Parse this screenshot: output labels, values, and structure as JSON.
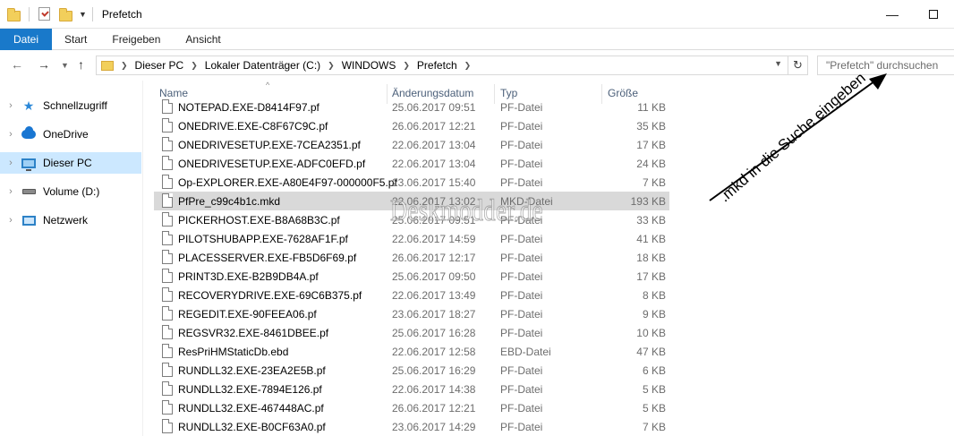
{
  "window": {
    "title": "Prefetch"
  },
  "ribbon": {
    "tabs": [
      "Datei",
      "Start",
      "Freigeben",
      "Ansicht"
    ]
  },
  "address": {
    "crumbs": [
      "Dieser PC",
      "Lokaler Datenträger (C:)",
      "WINDOWS",
      "Prefetch"
    ],
    "search_placeholder": "\"Prefetch\" durchsuchen"
  },
  "sidebar": {
    "items": [
      {
        "label": "Schnellzugriff",
        "icon": "star-icon"
      },
      {
        "label": "OneDrive",
        "icon": "cloud-icon"
      },
      {
        "label": "Dieser PC",
        "icon": "computer-icon",
        "selected": true
      },
      {
        "label": "Volume (D:)",
        "icon": "drive-icon"
      },
      {
        "label": "Netzwerk",
        "icon": "network-icon"
      }
    ]
  },
  "columns": {
    "name": "Name",
    "date": "Änderungsdatum",
    "type": "Typ",
    "size": "Größe"
  },
  "files": [
    {
      "name": "NOTEPAD.EXE-D8414F97.pf",
      "date": "25.06.2017 09:51",
      "type": "PF-Datei",
      "size": "11 KB"
    },
    {
      "name": "ONEDRIVE.EXE-C8F67C9C.pf",
      "date": "26.06.2017 12:21",
      "type": "PF-Datei",
      "size": "35 KB"
    },
    {
      "name": "ONEDRIVESETUP.EXE-7CEA2351.pf",
      "date": "22.06.2017 13:04",
      "type": "PF-Datei",
      "size": "17 KB"
    },
    {
      "name": "ONEDRIVESETUP.EXE-ADFC0EFD.pf",
      "date": "22.06.2017 13:04",
      "type": "PF-Datei",
      "size": "24 KB"
    },
    {
      "name": "Op-EXPLORER.EXE-A80E4F97-000000F5.pf",
      "date": "23.06.2017 15:40",
      "type": "PF-Datei",
      "size": "7 KB"
    },
    {
      "name": "PfPre_c99c4b1c.mkd",
      "date": "22.06.2017 13:02",
      "type": "MKD-Datei",
      "size": "193 KB",
      "selected": true
    },
    {
      "name": "PICKERHOST.EXE-B8A68B3C.pf",
      "date": "25.06.2017 09:51",
      "type": "PF-Datei",
      "size": "33 KB"
    },
    {
      "name": "PILOTSHUBAPP.EXE-7628AF1F.pf",
      "date": "22.06.2017 14:59",
      "type": "PF-Datei",
      "size": "41 KB"
    },
    {
      "name": "PLACESSERVER.EXE-FB5D6F69.pf",
      "date": "26.06.2017 12:17",
      "type": "PF-Datei",
      "size": "18 KB"
    },
    {
      "name": "PRINT3D.EXE-B2B9DB4A.pf",
      "date": "25.06.2017 09:50",
      "type": "PF-Datei",
      "size": "17 KB"
    },
    {
      "name": "RECOVERYDRIVE.EXE-69C6B375.pf",
      "date": "22.06.2017 13:49",
      "type": "PF-Datei",
      "size": "8 KB"
    },
    {
      "name": "REGEDIT.EXE-90FEEA06.pf",
      "date": "23.06.2017 18:27",
      "type": "PF-Datei",
      "size": "9 KB"
    },
    {
      "name": "REGSVR32.EXE-8461DBEE.pf",
      "date": "25.06.2017 16:28",
      "type": "PF-Datei",
      "size": "10 KB"
    },
    {
      "name": "ResPriHMStaticDb.ebd",
      "date": "22.06.2017 12:58",
      "type": "EBD-Datei",
      "size": "47 KB"
    },
    {
      "name": "RUNDLL32.EXE-23EA2E5B.pf",
      "date": "25.06.2017 16:29",
      "type": "PF-Datei",
      "size": "6 KB"
    },
    {
      "name": "RUNDLL32.EXE-7894E126.pf",
      "date": "22.06.2017 14:38",
      "type": "PF-Datei",
      "size": "5 KB"
    },
    {
      "name": "RUNDLL32.EXE-467448AC.pf",
      "date": "26.06.2017 12:21",
      "type": "PF-Datei",
      "size": "5 KB"
    },
    {
      "name": "RUNDLL32.EXE-B0CF63A0.pf",
      "date": "23.06.2017 14:29",
      "type": "PF-Datei",
      "size": "7 KB"
    }
  ],
  "annotation": {
    "text": ".mkd in die Suche eingeben"
  },
  "watermark": {
    "text": "Deskmodder.de"
  },
  "colors": {
    "accent": "#1979ca",
    "selection_sidebar": "#cce8ff",
    "selection_row": "#d9d9d9"
  }
}
